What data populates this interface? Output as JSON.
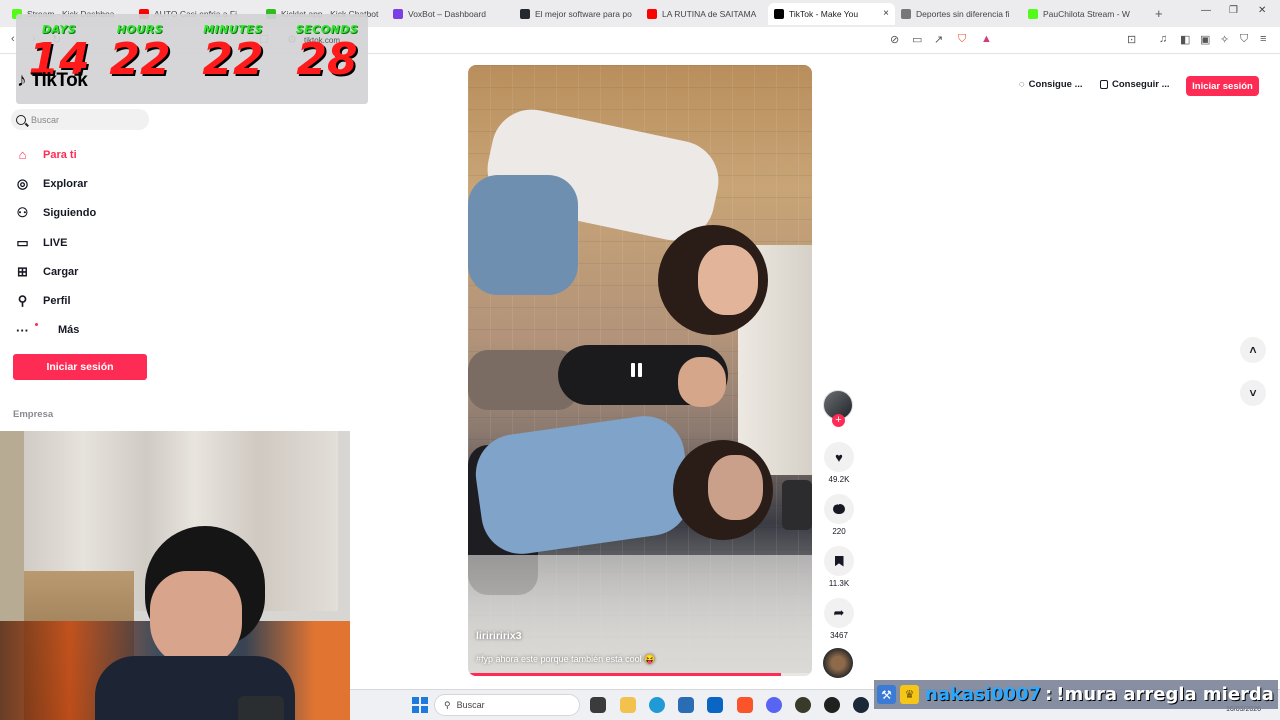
{
  "browser": {
    "tabs": [
      {
        "title": "Stream - Kick Dashboa",
        "icon": "kick-icon",
        "color": "#53fc18",
        "active": false
      },
      {
        "title": "AUTO Casi enfria a Fi",
        "icon": "youtube-icon",
        "color": "#ff0000",
        "active": false
      },
      {
        "title": "Kicklet.app - Kick Chatbot",
        "icon": "kicklet-icon",
        "color": "#2fbf1d",
        "active": false
      },
      {
        "title": "VoxBot – Dashboard",
        "icon": "voxbot-icon",
        "color": "#7b3fe4",
        "active": false
      },
      {
        "title": "El mejor software para po",
        "icon": "github-icon",
        "color": "#24292f",
        "active": false
      },
      {
        "title": "LA RUTINA de SAITAMA",
        "icon": "youtube-icon",
        "color": "#ff0000",
        "active": false
      },
      {
        "title": "TikTok - Make You",
        "icon": "tiktok-icon",
        "color": "#000000",
        "active": true
      },
      {
        "title": "Deportes sin diferencia fi",
        "icon": "globe-icon",
        "color": "#777777",
        "active": false
      },
      {
        "title": "PauChilota Stream - W",
        "icon": "kick-icon",
        "color": "#53fc18",
        "active": false
      }
    ],
    "new_tab": "+",
    "close_tab": "×",
    "url": "tiktok.com"
  },
  "countdown": {
    "units": [
      {
        "label": "DAYS",
        "value": "14"
      },
      {
        "label": "HOURS",
        "value": "22"
      },
      {
        "label": "MINUTES",
        "value": "22"
      },
      {
        "label": "SECONDS",
        "value": "28"
      }
    ]
  },
  "tiktok": {
    "logo": "TikTok",
    "search_placeholder": "Buscar",
    "nav": [
      {
        "label": "Para ti",
        "icon": "home-icon",
        "glyph": "⌂",
        "active": true
      },
      {
        "label": "Explorar",
        "icon": "compass-icon",
        "glyph": "◎",
        "active": false
      },
      {
        "label": "Siguiendo",
        "icon": "following-icon",
        "glyph": "⚇",
        "active": false
      },
      {
        "label": "LIVE",
        "icon": "live-icon",
        "glyph": "▭",
        "active": false
      },
      {
        "label": "Cargar",
        "icon": "upload-icon",
        "glyph": "⊞",
        "active": false
      },
      {
        "label": "Perfil",
        "icon": "profile-icon",
        "glyph": "⚲",
        "active": false
      },
      {
        "label": "Más",
        "icon": "more-icon",
        "glyph": "···",
        "active": false
      }
    ],
    "login_label": "Iniciar sesión",
    "empresa_label": "Empresa",
    "top_chips": [
      {
        "label": "Consigue ..."
      },
      {
        "label": "Conseguir ..."
      }
    ],
    "login_top_label": "Iniciar sesión",
    "video": {
      "author": "lirirіririx3",
      "caption": "#fyp ahora este porque también está cool 😝",
      "progress": 0.91
    },
    "stats": {
      "likes": "49.2K",
      "comments": "220",
      "saves": "11.3K",
      "shares": "3467"
    }
  },
  "taskbar": {
    "search_placeholder": "Buscar",
    "date": "16/03/2026"
  },
  "chat": {
    "user": "nakasi0007",
    "separator": ":",
    "message": "!mura arregla mierda"
  },
  "colors": {
    "brand": "#fe2c55",
    "timer_label": "#32e632",
    "timer_value": "#ff1b1b",
    "chat_user": "#2aa8ff"
  }
}
